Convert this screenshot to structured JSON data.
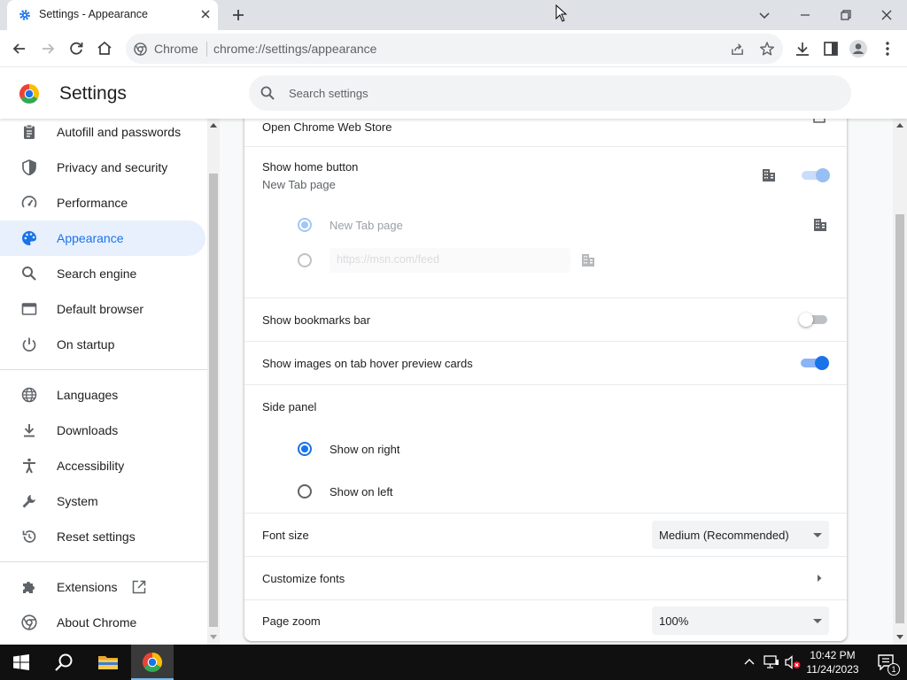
{
  "tab": {
    "title": "Settings - Appearance",
    "favicon": "gear-icon",
    "close": "close-icon"
  },
  "window": {
    "controls": [
      "chevron-down-icon",
      "minimize-icon",
      "restore-icon",
      "close-icon"
    ]
  },
  "toolbar": {
    "site_label": "Chrome",
    "url": "chrome://settings/appearance",
    "icons": [
      "back-icon",
      "forward-icon",
      "reload-icon",
      "home-icon",
      "share-icon",
      "star-icon",
      "download-icon",
      "side-panel-icon",
      "profile-icon",
      "more-icon"
    ]
  },
  "header": {
    "title": "Settings",
    "search_placeholder": "Search settings"
  },
  "sidebar": {
    "selected_index": 3,
    "items": [
      {
        "label": "Autofill and passwords",
        "icon": "clipboard-icon"
      },
      {
        "label": "Privacy and security",
        "icon": "shield-icon"
      },
      {
        "label": "Performance",
        "icon": "speedometer-icon"
      },
      {
        "label": "Appearance",
        "icon": "palette-icon"
      },
      {
        "label": "Search engine",
        "icon": "search-icon"
      },
      {
        "label": "Default browser",
        "icon": "browser-icon"
      },
      {
        "label": "On startup",
        "icon": "power-icon"
      },
      {
        "label": "Languages",
        "icon": "globe-icon"
      },
      {
        "label": "Downloads",
        "icon": "download-icon"
      },
      {
        "label": "Accessibility",
        "icon": "accessibility-icon"
      },
      {
        "label": "System",
        "icon": "wrench-icon"
      },
      {
        "label": "Reset settings",
        "icon": "reset-icon"
      },
      {
        "label": "Extensions",
        "icon": "puzzle-icon"
      },
      {
        "label": "About Chrome",
        "icon": "chrome-icon"
      }
    ]
  },
  "appearance": {
    "web_store": {
      "label": "Open Chrome Web Store",
      "icon": "open-external-icon"
    },
    "home_button": {
      "label": "Show home button",
      "sublabel": "New Tab page",
      "enabled": true,
      "managed": true,
      "options": [
        {
          "label": "New Tab page",
          "checked": true
        },
        {
          "label": "https://msn.com/feed",
          "checked": false
        }
      ]
    },
    "bookmarks_bar": {
      "label": "Show bookmarks bar",
      "enabled": false
    },
    "hover_preview": {
      "label": "Show images on tab hover preview cards",
      "enabled": true
    },
    "side_panel": {
      "label": "Side panel",
      "options": [
        {
          "label": "Show on right",
          "checked": true
        },
        {
          "label": "Show on left",
          "checked": false
        }
      ]
    },
    "font_size": {
      "label": "Font size",
      "value": "Medium (Recommended)"
    },
    "customize_fonts": {
      "label": "Customize fonts"
    },
    "page_zoom": {
      "label": "Page zoom",
      "value": "100%"
    }
  },
  "taskbar": {
    "time": "10:42 PM",
    "date": "11/24/2023",
    "notification_count": "1",
    "apps": [
      "windows-start-icon",
      "search-icon",
      "file-explorer-icon",
      "chrome-icon"
    ],
    "tray_icons": [
      "chevron-up-icon",
      "network-icon",
      "volume-muted-icon",
      "notification-icon"
    ]
  },
  "colors": {
    "accent": "#1a73e8",
    "selected_bg": "#e8f0fe",
    "tabstrip": "#dee1e6",
    "taskbar": "#101010"
  }
}
